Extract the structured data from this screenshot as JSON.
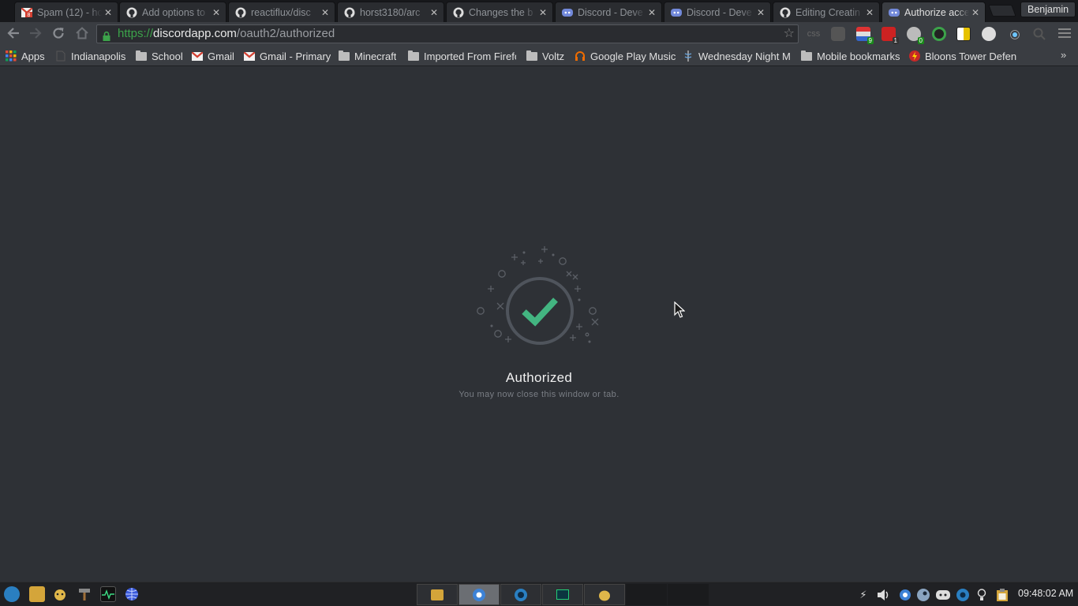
{
  "browser": {
    "tabs": [
      {
        "title": "Spam (12) - ho",
        "icon": "gmail-icon"
      },
      {
        "title": "Add options to",
        "icon": "github-icon"
      },
      {
        "title": "reactiflux/disc",
        "icon": "github-icon"
      },
      {
        "title": "horst3180/arc",
        "icon": "github-icon"
      },
      {
        "title": "Changes the b",
        "icon": "github-icon"
      },
      {
        "title": "Discord - Deve",
        "icon": "discord-icon"
      },
      {
        "title": "Discord - Deve",
        "icon": "discord-icon"
      },
      {
        "title": "Editing Creatin",
        "icon": "github-icon"
      },
      {
        "title": "Authorize acce",
        "icon": "discord-icon",
        "active": true
      }
    ],
    "gmail_badge": "8",
    "profile_name": "Benjamin",
    "url": {
      "scheme": "https://",
      "host": "discordapp.com",
      "path": "/oauth2/authorized"
    },
    "extension_badges": {
      "first": "9",
      "second": "1",
      "third": "0"
    },
    "css_ext_label": "css",
    "bookmarks": [
      {
        "label": "Apps",
        "icon": "apps-grid-icon"
      },
      {
        "label": "Indianapolis",
        "icon": "page-icon"
      },
      {
        "label": "School",
        "icon": "folder-icon"
      },
      {
        "label": "Gmail",
        "icon": "gmail-icon"
      },
      {
        "label": "Gmail - Primary",
        "icon": "gmail-icon"
      },
      {
        "label": "Minecraft",
        "icon": "folder-icon"
      },
      {
        "label": "Imported From Firefox",
        "icon": "folder-icon"
      },
      {
        "label": "Voltz",
        "icon": "folder-icon"
      },
      {
        "label": "Google Play Music",
        "icon": "headphones-icon"
      },
      {
        "label": "Wednesday Night M",
        "icon": "caduceus-icon"
      },
      {
        "label": "Mobile bookmarks",
        "icon": "folder-icon"
      },
      {
        "label": "Bloons Tower Defen",
        "icon": "lightning-icon"
      }
    ]
  },
  "page": {
    "title": "Authorized",
    "subtitle": "You may now close this window or tab.",
    "accent_color": "#43b581"
  },
  "taskbar": {
    "clock": "09:48:02 AM"
  }
}
